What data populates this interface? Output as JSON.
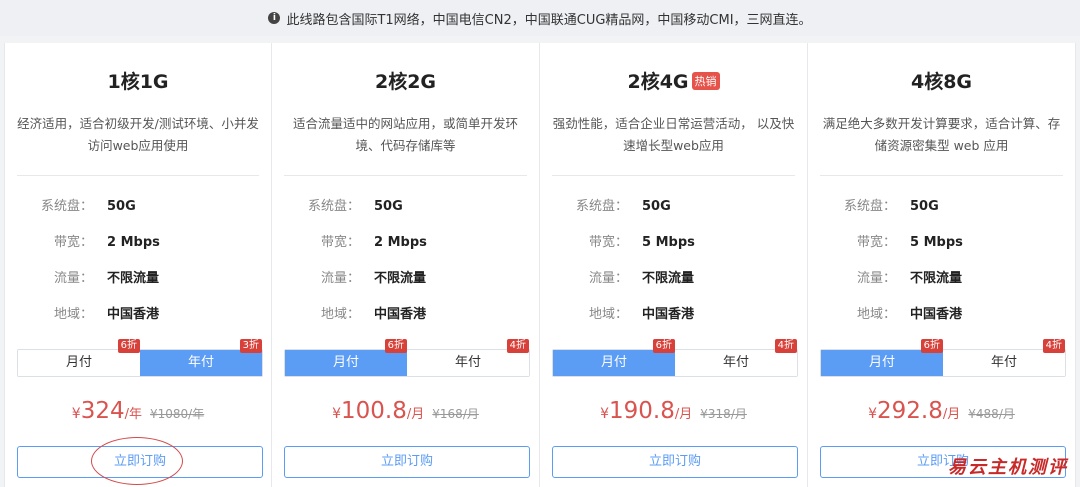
{
  "notice": {
    "icon": "info-icon",
    "text": "此线路包含国际T1网络，中国电信CN2，中国联通CUG精品网，中国移动CMI，三网直连。"
  },
  "spec_labels": {
    "disk": "系统盘：",
    "bandwidth": "带宽：",
    "traffic": "流量：",
    "region": "地域："
  },
  "buy_label": "立即订购",
  "plans": [
    {
      "title": "1核1G",
      "badge": "",
      "desc": "经济适用，适合初级开发/测试环境、小并发访问web应用使用",
      "disk": "50G",
      "bandwidth": "2 Mbps",
      "traffic": "不限流量",
      "region": "中国香港",
      "monthly_label": "月付",
      "monthly_discount": "6折",
      "yearly_label": "年付",
      "yearly_discount": "3折",
      "selected": "yearly",
      "price_currency": "¥",
      "price": "324",
      "price_unit": "/年",
      "price_old": "¥1080/年"
    },
    {
      "title": "2核2G",
      "badge": "",
      "desc": "适合流量适中的网站应用，或简单开发环境、代码存储库等",
      "disk": "50G",
      "bandwidth": "2 Mbps",
      "traffic": "不限流量",
      "region": "中国香港",
      "monthly_label": "月付",
      "monthly_discount": "6折",
      "yearly_label": "年付",
      "yearly_discount": "4折",
      "selected": "monthly",
      "price_currency": "¥",
      "price": "100.8",
      "price_unit": "/月",
      "price_old": "¥168/月"
    },
    {
      "title": "2核4G",
      "badge": "热销",
      "desc": "强劲性能，适合企业日常运营活动， 以及快速增长型web应用",
      "disk": "50G",
      "bandwidth": "5 Mbps",
      "traffic": "不限流量",
      "region": "中国香港",
      "monthly_label": "月付",
      "monthly_discount": "6折",
      "yearly_label": "年付",
      "yearly_discount": "4折",
      "selected": "monthly",
      "price_currency": "¥",
      "price": "190.8",
      "price_unit": "/月",
      "price_old": "¥318/月"
    },
    {
      "title": "4核8G",
      "badge": "",
      "desc": "满足绝大多数开发计算要求，适合计算、存储资源密集型 web 应用",
      "disk": "50G",
      "bandwidth": "5 Mbps",
      "traffic": "不限流量",
      "region": "中国香港",
      "monthly_label": "月付",
      "monthly_discount": "6折",
      "yearly_label": "年付",
      "yearly_discount": "4折",
      "selected": "monthly",
      "price_currency": "¥",
      "price": "292.8",
      "price_unit": "/月",
      "price_old": "¥488/月"
    }
  ],
  "watermark": "易云主机测评",
  "colors": {
    "accent": "#5b9cf5",
    "price": "#d9534f",
    "discount": "#d7413a",
    "hot_badge": "#e5534b"
  }
}
